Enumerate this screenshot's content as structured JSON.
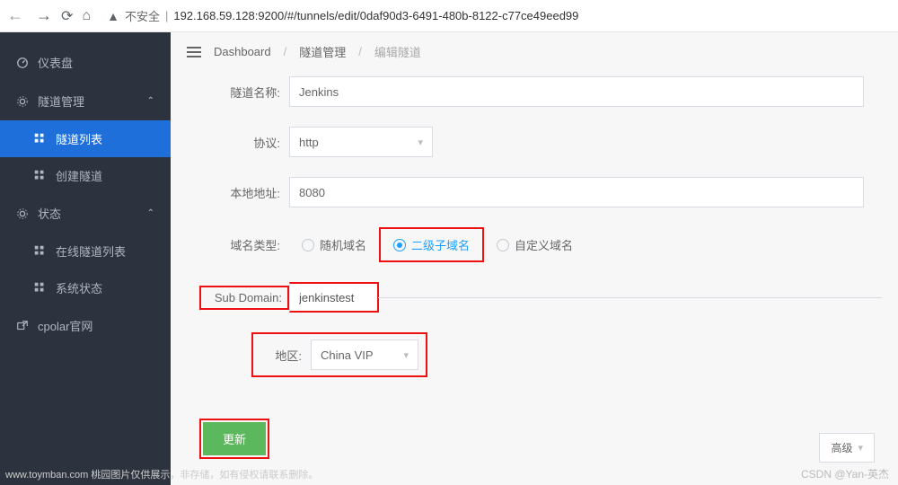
{
  "browser": {
    "insecure_label": "不安全",
    "url": "192.168.59.128:9200/#/tunnels/edit/0daf90d3-6491-480b-8122-c77ce49eed99"
  },
  "sidebar": {
    "dashboard": "仪表盘",
    "tunnels": "隧道管理",
    "tunnel_list": "隧道列表",
    "create_tunnel": "创建隧道",
    "status": "状态",
    "online_list": "在线隧道列表",
    "system_status": "系统状态",
    "cpolar": "cpolar官网"
  },
  "breadcrumb": {
    "c1": "Dashboard",
    "c2": "隧道管理",
    "c3": "编辑隧道"
  },
  "form": {
    "name_label": "隧道名称:",
    "name_value": "Jenkins",
    "proto_label": "协议:",
    "proto_value": "http",
    "addr_label": "本地地址:",
    "addr_value": "8080",
    "domain_type_label": "域名类型:",
    "dt_random": "随机域名",
    "dt_sub": "二级子域名",
    "dt_custom": "自定义域名",
    "subdomain_label": "Sub Domain:",
    "subdomain_value": "jenkinstest",
    "region_label": "地区:",
    "region_value": "China VIP",
    "advanced": "高级",
    "update": "更新"
  },
  "footer": {
    "csdn": "CSDN @Yan-英杰",
    "left": "www.toymban.com 桃园图片仅供展示，非存储，如有侵权请联系删除。"
  }
}
